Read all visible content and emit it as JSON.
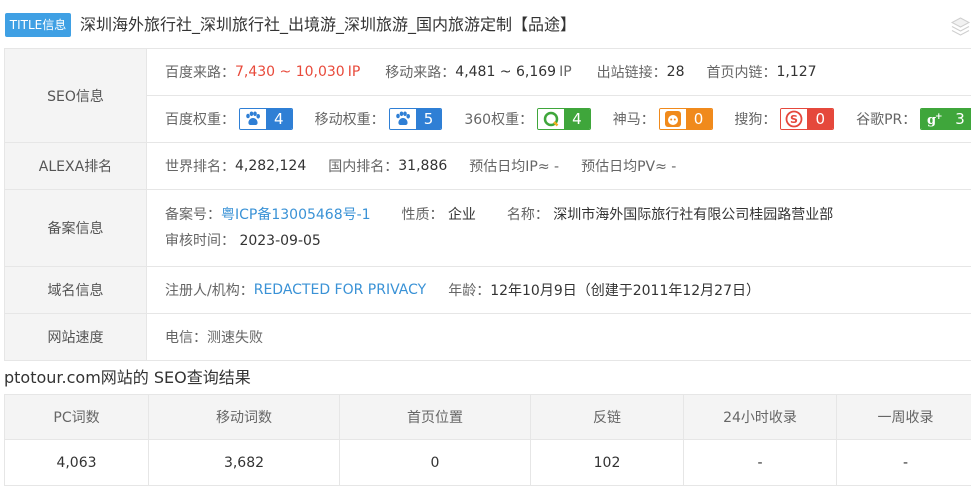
{
  "title": {
    "badge": "TITLE信息",
    "text": "深圳海外旅行社_深圳旅行社_出境游_深圳旅游_国内旅游定制【品途】",
    "icon": "layers-icon"
  },
  "seo": {
    "label": "SEO信息",
    "baidu_source_label": "百度来路：",
    "baidu_source_value": "7,430 ~ 10,030",
    "baidu_source_unit": "IP",
    "mobile_source_label": "移动来路：",
    "mobile_source_value": "4,481 ~ 6,169",
    "mobile_source_unit": "IP",
    "outlinks_label": "出站链接：",
    "outlinks_value": "28",
    "inlinks_label": "首页内链：",
    "inlinks_value": "1,127",
    "weights": [
      {
        "label": "百度权重：",
        "icon": "baidu-paw-icon",
        "value": "4"
      },
      {
        "label": "移动权重：",
        "icon": "baidu-paw-icon",
        "value": "5"
      },
      {
        "label": "360权重：",
        "icon": "360-search-icon",
        "value": "4"
      },
      {
        "label": "神马：",
        "icon": "shenma-icon",
        "value": "0"
      },
      {
        "label": "搜狗：",
        "icon": "sogou-icon",
        "value": "0"
      },
      {
        "label": "谷歌PR：",
        "icon": "google-plus-icon",
        "value": "3"
      }
    ]
  },
  "alexa": {
    "label": "ALEXA排名",
    "world_label": "世界排名：",
    "world_value": "4,282,124",
    "domestic_label": "国内排名：",
    "domestic_value": "31,886",
    "ip_label": "预估日均IP≈ -",
    "pv_label": "预估日均PV≈ -"
  },
  "beian": {
    "label": "备案信息",
    "number_label": "备案号：",
    "number_value": "粤ICP备13005468号-1",
    "nature_label": "性质：",
    "nature_value": "企业",
    "name_label": "名称：",
    "name_value": "深圳市海外国际旅行社有限公司桂园路营业部",
    "review_label": "审核时间：",
    "review_value": "2023-09-05"
  },
  "domain": {
    "label": "域名信息",
    "registrant_label": "注册人/机构：",
    "registrant_value": "REDACTED FOR PRIVACY",
    "age_label": "年龄：",
    "age_value": "12年10月9日（创建于2011年12月27日）"
  },
  "speed": {
    "label": "网站速度",
    "value": "电信：测速失败"
  },
  "results": {
    "title": "ptotour.com网站的 SEO查询结果",
    "headers": [
      "PC词数",
      "移动词数",
      "首页位置",
      "反链",
      "24小时收录",
      "一周收录"
    ],
    "row": [
      "4,063",
      "3,682",
      "0",
      "102",
      "-",
      "-"
    ]
  },
  "colors": {
    "badge_blue": "#3fa0e4",
    "baidu": "#2f7fd5",
    "q360": "#3fa63b",
    "shenma": "#f08a1c",
    "sogou": "#e5483c",
    "link": "#3a92d6",
    "red": "#e84a3b"
  }
}
